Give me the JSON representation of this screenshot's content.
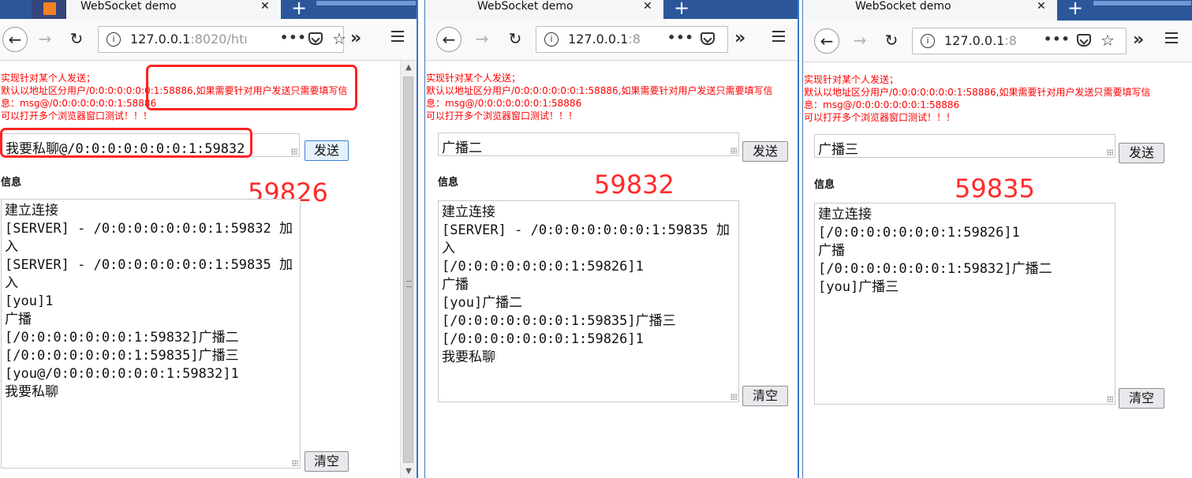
{
  "tab_title": "WebSocket demo",
  "tab_close": "✕",
  "new_tab_glyph": "+",
  "nav": {
    "back_glyph": "←",
    "forward_glyph": "→",
    "reload_glyph": "↻",
    "info_glyph": "i",
    "ellipsis": "•••",
    "star_glyph": "☆",
    "overflow_glyph": "»"
  },
  "hint_lines": {
    "line1": "实现针对某个人发送；",
    "line2": "默认以地址区分用户/0:0:0:0:0:0:0:1:58886,如果需要针对用户发送只需要填写信息：msg@/0:0:0:0:0:0:0:1:58886",
    "line3": "可以打开多个浏览器窗口测试！！！"
  },
  "send_button": "发送",
  "clear_button": "清空",
  "info_label": "信息",
  "windows": [
    {
      "url_main": "127.0.0.1",
      "url_dim": ":8020/htı",
      "input_value": "我要私聊@/0:0:0:0:0:0:0:1:59832",
      "port_annotation": "59826",
      "log": [
        "建立连接",
        "[SERVER] - /0:0:0:0:0:0:0:1:59832 加入",
        "[SERVER] - /0:0:0:0:0:0:0:1:59835 加入",
        "[you]1",
        "广播",
        "[/0:0:0:0:0:0:0:1:59832]广播二",
        "[/0:0:0:0:0:0:0:1:59835]广播三",
        "[you@/0:0:0:0:0:0:0:1:59832]1",
        "我要私聊"
      ]
    },
    {
      "url_main": "127.0.0.1",
      "url_dim": ":8",
      "input_value": "广播二",
      "port_annotation": "59832",
      "log": [
        "建立连接",
        "[SERVER] - /0:0:0:0:0:0:0:1:59835 加入",
        "[/0:0:0:0:0:0:0:1:59826]1",
        "广播",
        "[you]广播二",
        "[/0:0:0:0:0:0:0:1:59835]广播三",
        "[/0:0:0:0:0:0:0:1:59826]1",
        "我要私聊"
      ]
    },
    {
      "url_main": "127.0.0.1",
      "url_dim": ":8",
      "input_value": "广播三",
      "port_annotation": "59835",
      "log": [
        "建立连接",
        "[/0:0:0:0:0:0:0:1:59826]1",
        "广播",
        "[/0:0:0:0:0:0:0:1:59832]广播二",
        "[you]广播三"
      ]
    }
  ],
  "colors": {
    "hint_text": "#ff0000",
    "annotation_red": "#ff2a2a",
    "tabstrip_blue": "#2b579a"
  }
}
